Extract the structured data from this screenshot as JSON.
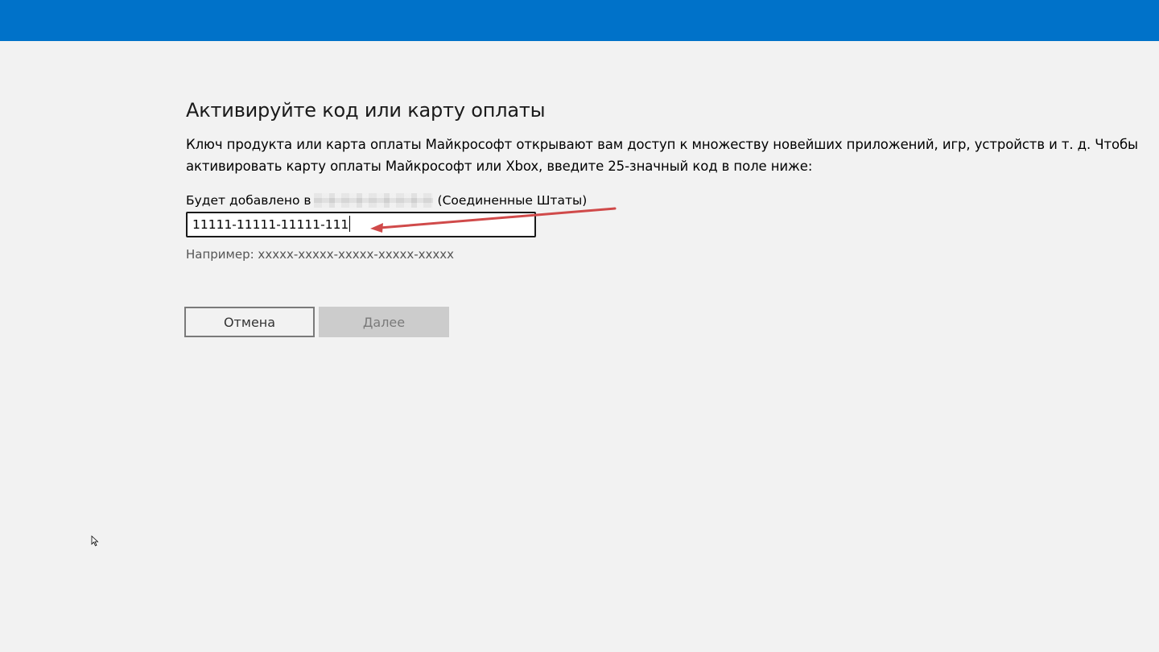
{
  "header": {
    "color": "#0072c9"
  },
  "page": {
    "title": "Активируйте код или карту оплаты",
    "description": "Ключ продукта или карта оплаты Майкрософт открывают вам доступ к множеству новейших приложений, игр, устройств и т. д. Чтобы активировать карту оплаты Майкрософт или Xbox, введите 25-значный код в поле ниже:",
    "account_prefix": "Будет добавлено в",
    "account_suffix": "(Соединенные Штаты)",
    "code_value": "11111-11111-11111-111",
    "example_hint": "Например: xxxxx-xxxxx-xxxxx-xxxxx-xxxxx"
  },
  "buttons": {
    "cancel_label": "Отмена",
    "next_label": "Далее"
  },
  "annotation": {
    "arrow_color": "#d04a4a"
  },
  "icons": {
    "cursor": "mouse-pointer-icon"
  }
}
